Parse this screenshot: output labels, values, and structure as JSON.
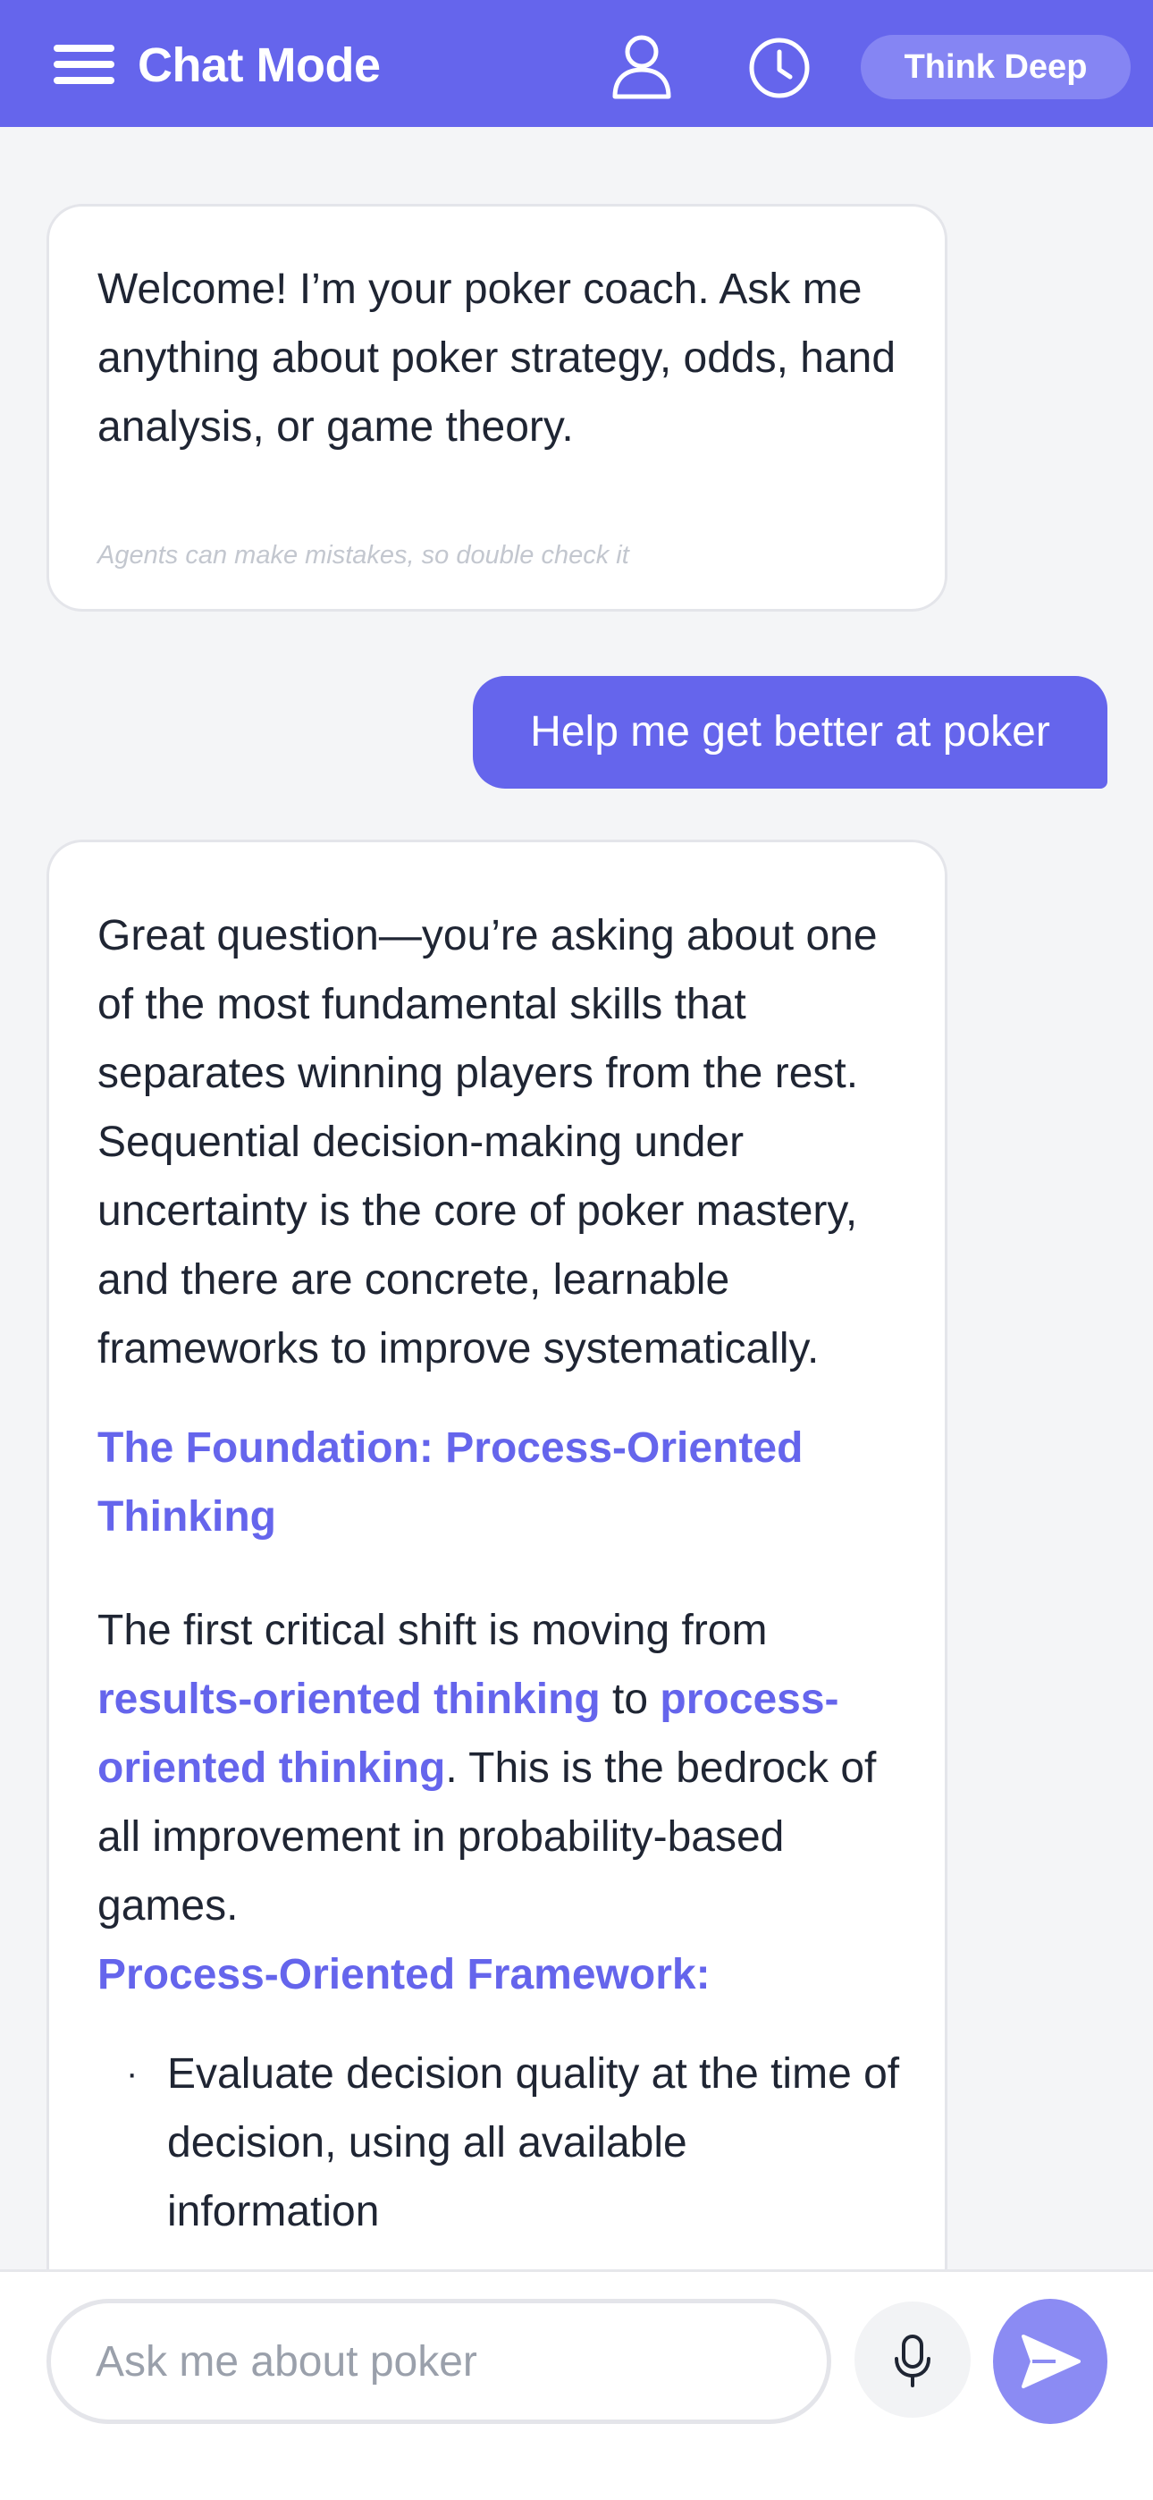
{
  "header": {
    "title": "Chat Mode",
    "think_button": "Think Deep",
    "icons": [
      "menu-icon",
      "user-icon",
      "clock-icon"
    ],
    "accent_color": "#6565ec"
  },
  "messages": {
    "welcome": {
      "text": "Welcome! I’m your poker coach. Ask me anything about poker strategy, odds, hand analysis, or game theory.",
      "disclaimer": "Agents can make mistakes, so double check it"
    },
    "user": {
      "text": "Help me get better at poker"
    },
    "answer": {
      "intro": "Great question—you’re asking about one of the most fundamental skills that separates winning players from the rest. Sequential decision-making under uncertainty is the core of poker mastery, and there are concrete, learnable frameworks to improve systematically.",
      "heading1": "The Foundation: Process-Oriented Thinking",
      "para2_start": "The first critical shift is moving from ",
      "para2_hl1": "results-oriented thinking",
      "para2_mid": " to ",
      "para2_hl2": "process-oriented thinking",
      "para2_end": ". This is the bedrock of all improvement in probability-based games.",
      "heading2": "Process-Oriented Framework:",
      "bullet_dot": "·",
      "bullets": [
        "Evaluate decision quality at the time of decision, using all available information"
      ]
    }
  },
  "input": {
    "placeholder": "Ask me about poker",
    "value": ""
  }
}
